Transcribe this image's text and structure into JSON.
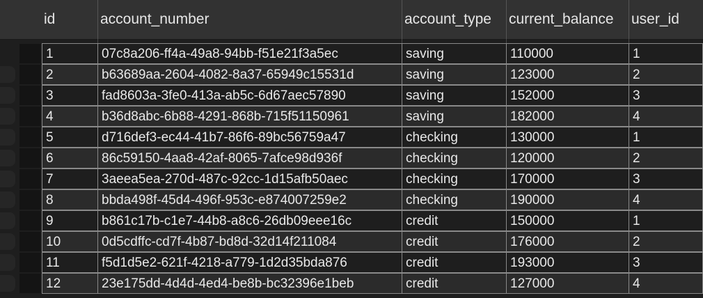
{
  "table": {
    "columns": [
      "id",
      "account_number",
      "account_type",
      "current_balance",
      "user_id"
    ],
    "rows": [
      {
        "id": "1",
        "account_number": "07c8a206-ff4a-49a8-94bb-f51e21f3a5ec",
        "account_type": "saving",
        "current_balance": "110000",
        "user_id": "1"
      },
      {
        "id": "2",
        "account_number": "b63689aa-2604-4082-8a37-65949c15531d",
        "account_type": "saving",
        "current_balance": "123000",
        "user_id": "2"
      },
      {
        "id": "3",
        "account_number": "fad8603a-3fe0-413a-ab5c-6d67aec57890",
        "account_type": "saving",
        "current_balance": "152000",
        "user_id": "3"
      },
      {
        "id": "4",
        "account_number": "b36d8abc-6b88-4291-868b-715f51150961",
        "account_type": "saving",
        "current_balance": "182000",
        "user_id": "4"
      },
      {
        "id": "5",
        "account_number": "d716def3-ec44-41b7-86f6-89bc56759a47",
        "account_type": "checking",
        "current_balance": "130000",
        "user_id": "1"
      },
      {
        "id": "6",
        "account_number": "86c59150-4aa8-42af-8065-7afce98d936f",
        "account_type": "checking",
        "current_balance": "120000",
        "user_id": "2"
      },
      {
        "id": "7",
        "account_number": "3aeea5ea-270d-487c-92cc-1d15afb50aec",
        "account_type": "checking",
        "current_balance": "170000",
        "user_id": "3"
      },
      {
        "id": "8",
        "account_number": "bbda498f-45d4-496f-953c-e874007259e2",
        "account_type": "checking",
        "current_balance": "190000",
        "user_id": "4"
      },
      {
        "id": "9",
        "account_number": "b861c17b-c1e7-44b8-a8c6-26db09eee16c",
        "account_type": "credit",
        "current_balance": "150000",
        "user_id": "1"
      },
      {
        "id": "10",
        "account_number": "0d5cdffc-cd7f-4b87-bd8d-32d14f211084",
        "account_type": "credit",
        "current_balance": "176000",
        "user_id": "2"
      },
      {
        "id": "11",
        "account_number": "f5d1d5e2-621f-4218-a779-1d2d35bda876",
        "account_type": "credit",
        "current_balance": "193000",
        "user_id": "3"
      },
      {
        "id": "12",
        "account_number": "23e175dd-4d4d-4ed4-be8b-bc32396e1beb",
        "account_type": "credit",
        "current_balance": "127000",
        "user_id": "4"
      }
    ]
  }
}
